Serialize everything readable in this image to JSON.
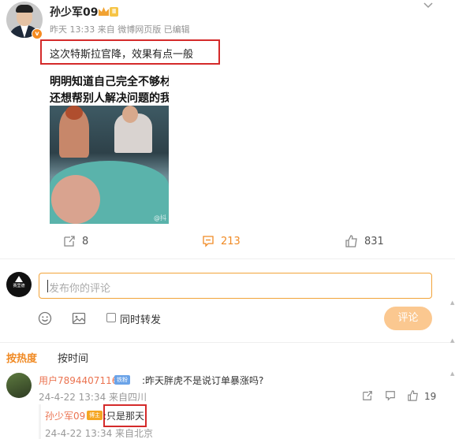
{
  "post": {
    "username": "孙少军09",
    "level": "Ⅱ",
    "verified_badge": "v",
    "meta": "昨天 13:33  来自 微博网页版  已编辑",
    "text": "这次特斯拉官降，效果有点一般",
    "video": {
      "caption_line1": "明明知道自己完全不够材",
      "caption_line2": "还想帮别人解决问题的我",
      "watermark": "@抖"
    },
    "actions": {
      "reposts": "8",
      "comments": "213",
      "likes": "831"
    }
  },
  "composer": {
    "avatar_text": "赛里德",
    "avatar_sub": "ZIDREE SHREWD",
    "placeholder": "发布你的评论",
    "repost_label": "同时转发",
    "submit_label": "评论"
  },
  "sort": {
    "hot": "按热度",
    "time": "按时间"
  },
  "comments": [
    {
      "user": "用户7894407116",
      "badge": "铁粉",
      "text": ":昨天胖虎不是说订单暴涨吗?",
      "meta": "24-4-22 13:34  来自四川",
      "likes": "19",
      "reply": {
        "user": "孙少军09",
        "badge": "博主",
        "text": ":只是那天",
        "meta": "24-4-22 13:34  来自北京"
      }
    }
  ],
  "colors": {
    "accent": "#f08a24",
    "username_link": "#eb7350",
    "highlight_box": "#d42a2a",
    "submit_disabled": "#fbc890"
  }
}
